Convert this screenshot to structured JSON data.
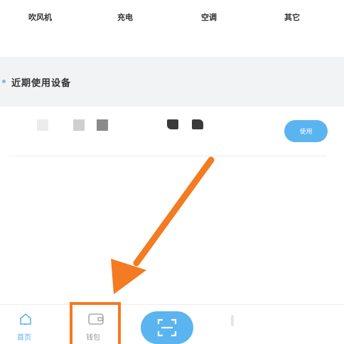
{
  "categories": [
    "吹风机",
    "充电",
    "空调",
    "其它"
  ],
  "recent_section": {
    "title": "近期使用设备"
  },
  "device_row": {
    "use_label": "使用"
  },
  "tabbar": {
    "home_label": "首页",
    "wallet_label": "钱包",
    "scan_icon": "scan-icon"
  },
  "colors": {
    "accent": "#5ab4ef",
    "annotation": "#f37b21",
    "band": "#f2f3f5"
  }
}
